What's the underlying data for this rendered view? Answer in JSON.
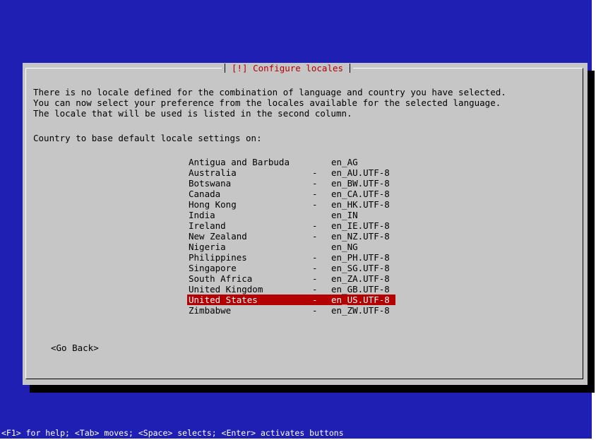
{
  "dialog": {
    "title": "[!] Configure locales",
    "message_lines": [
      "There is no locale defined for the combination of language and country you have selected.",
      "You can now select your preference from the locales available for the selected language.",
      "The locale that will be used is listed in the second column."
    ],
    "prompt": "Country to base default locale settings on:",
    "countries": [
      {
        "name": "Antigua and Barbuda",
        "dash": "",
        "locale": "en_AG"
      },
      {
        "name": "Australia",
        "dash": "-",
        "locale": "en_AU.UTF-8"
      },
      {
        "name": "Botswana",
        "dash": "-",
        "locale": "en_BW.UTF-8"
      },
      {
        "name": "Canada",
        "dash": "-",
        "locale": "en_CA.UTF-8"
      },
      {
        "name": "Hong Kong",
        "dash": "-",
        "locale": "en_HK.UTF-8"
      },
      {
        "name": "India",
        "dash": "",
        "locale": "en_IN"
      },
      {
        "name": "Ireland",
        "dash": "-",
        "locale": "en_IE.UTF-8"
      },
      {
        "name": "New Zealand",
        "dash": "-",
        "locale": "en_NZ.UTF-8"
      },
      {
        "name": "Nigeria",
        "dash": "",
        "locale": "en_NG"
      },
      {
        "name": "Philippines",
        "dash": "-",
        "locale": "en_PH.UTF-8"
      },
      {
        "name": "Singapore",
        "dash": "-",
        "locale": "en_SG.UTF-8"
      },
      {
        "name": "South Africa",
        "dash": "-",
        "locale": "en_ZA.UTF-8"
      },
      {
        "name": "United Kingdom",
        "dash": "-",
        "locale": "en_GB.UTF-8"
      },
      {
        "name": "United States",
        "dash": "-",
        "locale": "en_US.UTF-8"
      },
      {
        "name": "Zimbabwe",
        "dash": "-",
        "locale": "en_ZW.UTF-8"
      }
    ],
    "selected_country": "United States",
    "back_label": "<Go Back>"
  },
  "status_bar": "<F1> for help; <Tab> moves; <Space> selects; <Enter> activates buttons",
  "colors": {
    "background": "#1f1fb4",
    "dialog": "#c6c6c6",
    "highlight": "#b40000",
    "title_text": "#b40000"
  }
}
